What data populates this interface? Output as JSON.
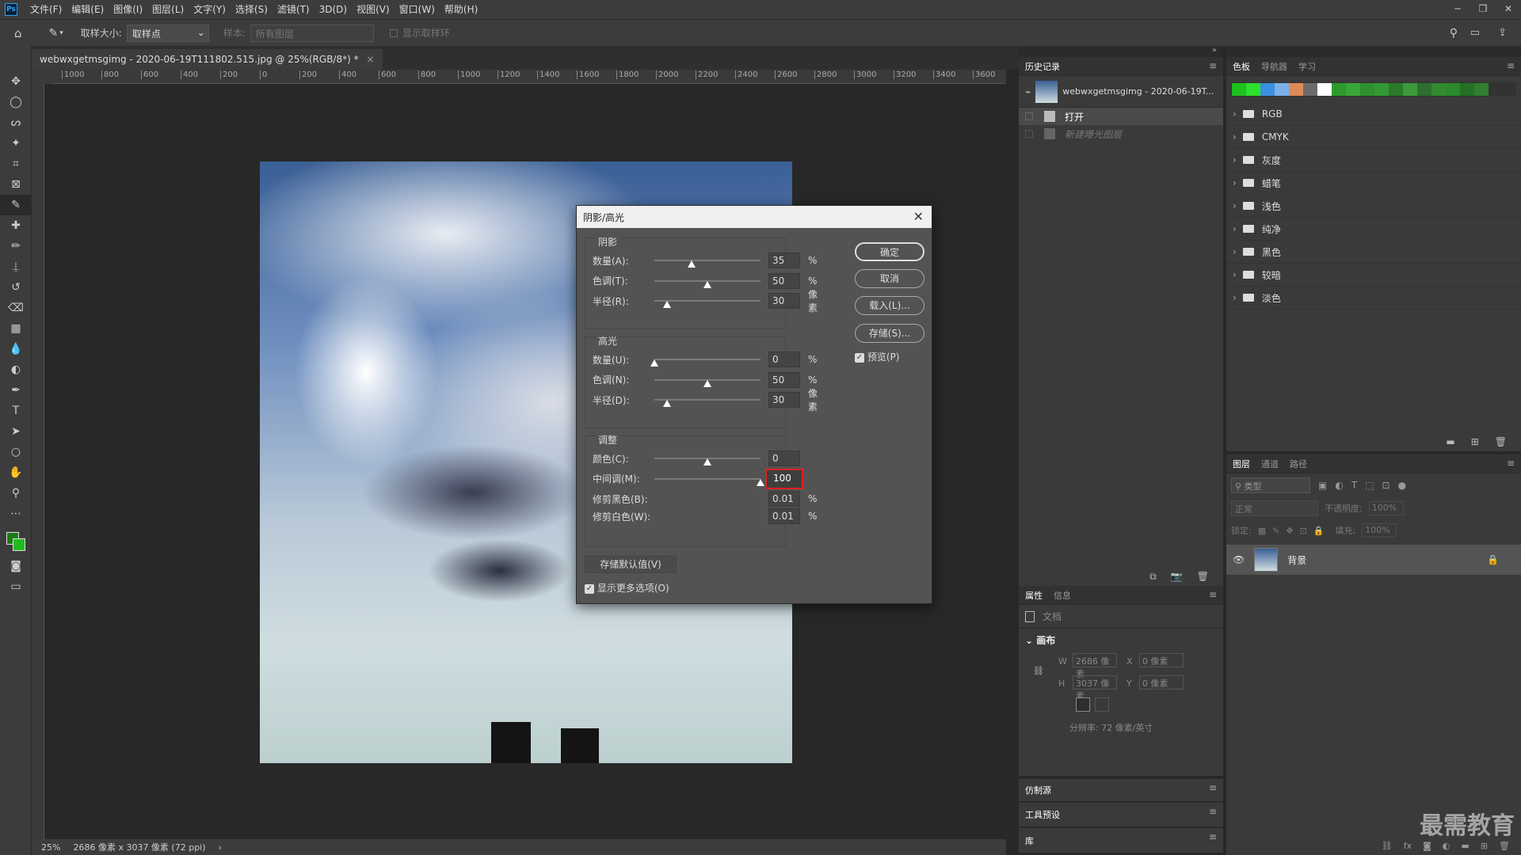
{
  "menubar": {
    "logo": "Ps",
    "items": [
      "文件(F)",
      "编辑(E)",
      "图像(I)",
      "图层(L)",
      "文字(Y)",
      "选择(S)",
      "滤镜(T)",
      "3D(D)",
      "视图(V)",
      "窗口(W)",
      "帮助(H)"
    ],
    "window_controls": [
      "─",
      "❐",
      "✕"
    ]
  },
  "options": {
    "sample_size_label": "取样大小:",
    "sample_size_value": "取样点",
    "sample_label": "样本:",
    "sample_value": "所有图层",
    "show_ring_label": "显示取样环"
  },
  "document": {
    "tab_title": "webwxgetmsgimg - 2020-06-19T111802.515.jpg @ 25%(RGB/8*) *",
    "close": "×"
  },
  "ruler": {
    "h_ticks": [
      "1000",
      "800",
      "600",
      "400",
      "200",
      "0",
      "200",
      "400",
      "600",
      "800",
      "1000",
      "1200",
      "1400",
      "1600",
      "1800",
      "2000",
      "2200",
      "2400",
      "2600",
      "2800",
      "3000",
      "3200",
      "3400",
      "3600"
    ]
  },
  "status": {
    "zoom": "25%",
    "doc_info": "2686 像素 x 3037 像素 (72 ppi)",
    "arrow": "›"
  },
  "history_panel": {
    "tab": "历史记录",
    "snapshot_label": "webwxgetmsgimg - 2020-06-19T...",
    "items": [
      {
        "label": "打开",
        "active": true
      },
      {
        "label": "新建曝光图层",
        "active": false
      }
    ]
  },
  "swatches_panel": {
    "tabs": [
      "色板",
      "导航器",
      "学习"
    ],
    "colors": [
      "#1fbf1f",
      "#2be02b",
      "#3a8fe0",
      "#7ab0e8",
      "#e08a5a",
      "#6b6b6b",
      "#ffffff",
      "#2e9a2e",
      "#3aa63a",
      "#2f8f2f",
      "#339933",
      "#2a7a2a",
      "#3b9a3b",
      "#2e6e2e",
      "#318a31",
      "#2a8a2a",
      "#247024",
      "#2f7f2f"
    ],
    "folders": [
      "RGB",
      "CMYK",
      "灰度",
      "蜡笔",
      "浅色",
      "纯净",
      "黑色",
      "较暗",
      "淡色"
    ]
  },
  "layers_panel": {
    "tabs": [
      "图层",
      "通道",
      "路径"
    ],
    "kind_filter": "类型",
    "blend_mode": "正常",
    "opacity_label": "不透明度:",
    "opacity_value": "100%",
    "lock_label": "锁定:",
    "fill_label": "填充:",
    "fill_value": "100%",
    "layer_name": "背景"
  },
  "properties_panel": {
    "tabs": [
      "属性",
      "信息"
    ],
    "doc_label": "文档",
    "canvas_label": "画布",
    "w_label": "W",
    "w_value": "2686 像素",
    "h_label": "H",
    "h_value": "3037 像素",
    "x_label": "X",
    "x_value": "0 像素",
    "y_label": "Y",
    "y_value": "0 像素",
    "resolution": "分辨率: 72 像素/英寸"
  },
  "collapsed_panels": [
    "仿制源",
    "工具预设",
    "库"
  ],
  "watermark": "最需教育",
  "dialog": {
    "title": "阴影/高光",
    "close": "✕",
    "shadow": {
      "title": "阴影",
      "rows": [
        {
          "label": "数量(A):",
          "value": "35",
          "unit": "%",
          "pos": 0.35
        },
        {
          "label": "色调(T):",
          "value": "50",
          "unit": "%",
          "pos": 0.5
        },
        {
          "label": "半径(R):",
          "value": "30",
          "unit": "像素",
          "pos": 0.12
        }
      ]
    },
    "highlight": {
      "title": "高光",
      "rows": [
        {
          "label": "数量(U):",
          "value": "0",
          "unit": "%",
          "pos": 0.0
        },
        {
          "label": "色调(N):",
          "value": "50",
          "unit": "%",
          "pos": 0.5
        },
        {
          "label": "半径(D):",
          "value": "30",
          "unit": "像素",
          "pos": 0.12
        }
      ]
    },
    "adjust": {
      "title": "调整",
      "rows": [
        {
          "label": "颜色(C):",
          "value": "0",
          "unit": "",
          "pos": 0.5
        },
        {
          "label": "中间调(M):",
          "value": "100",
          "unit": "",
          "pos": 1.0
        },
        {
          "label": "修剪黑色(B):",
          "value": "0.01",
          "unit": "%"
        },
        {
          "label": "修剪白色(W):",
          "value": "0.01",
          "unit": "%"
        }
      ]
    },
    "buttons": {
      "ok": "确定",
      "cancel": "取消",
      "load": "载入(L)...",
      "save": "存储(S)...",
      "preview": "预览(P)",
      "save_default": "存储默认值(V)",
      "more_options": "显示更多选项(O)"
    },
    "highlight_color": "#e02020"
  }
}
